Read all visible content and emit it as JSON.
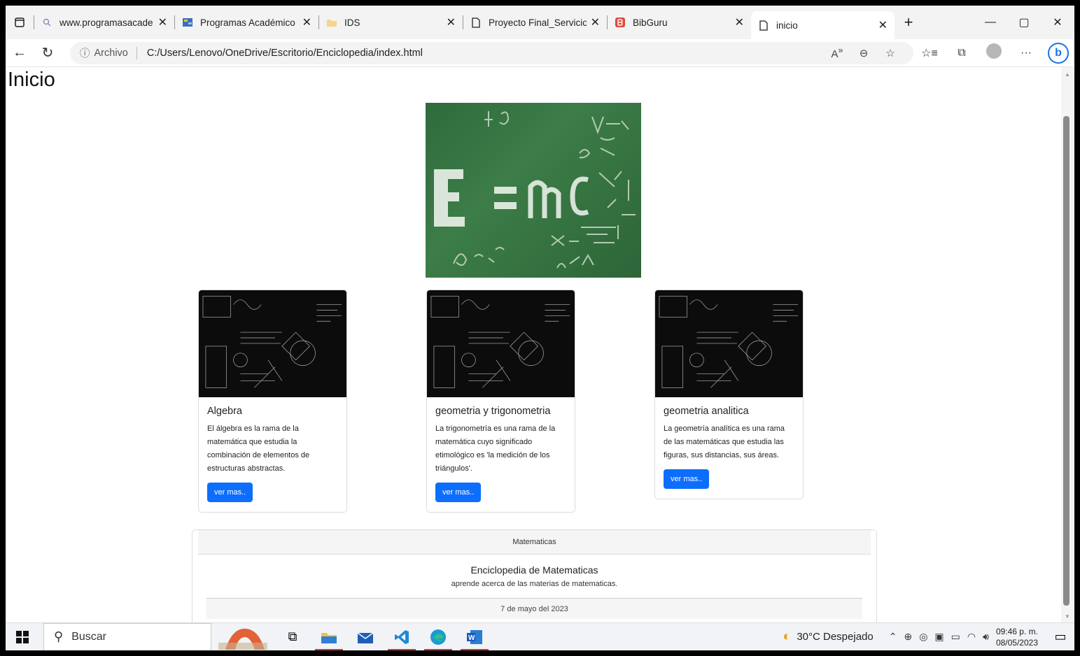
{
  "browser": {
    "tabs": [
      {
        "title": "www.programasacade",
        "icon": "search-icon"
      },
      {
        "title": "Programas Académico",
        "icon": "site-icon"
      },
      {
        "title": "IDS",
        "icon": "folder-icon"
      },
      {
        "title": "Proyecto Final_Servicio",
        "icon": "document-icon"
      },
      {
        "title": "BibGuru",
        "icon": "bibguru-icon"
      },
      {
        "title": "inicio",
        "icon": "document-icon"
      }
    ],
    "address_prefix": "Archivo",
    "url": "C:/Users/Lenovo/OneDrive/Escritorio/Enciclopedia/index.html"
  },
  "page": {
    "title": "Inicio",
    "cards": [
      {
        "title": "Algebra",
        "text": "El álgebra es la rama de la matemática que estudia la combinación de elementos de estructuras abstractas.",
        "button": "ver mas.."
      },
      {
        "title": "geometria y trigonometria",
        "text": "La trigonometría es una rama de la matemática cuyo significado etimológico es 'la medición de los triángulos'.",
        "button": "ver mas.."
      },
      {
        "title": "geometria analitica",
        "text": "La geometría analítica es una rama de las matemáticas que estudia las figuras, sus distancias, sus áreas.",
        "button": "ver mas.."
      }
    ],
    "footer": {
      "header": "Matematicas",
      "title": "Enciclopedia de Matematicas",
      "subtitle": "aprende acerca de las materias de matematicas.",
      "date": "7 de mayo del 2023"
    }
  },
  "taskbar": {
    "search": "Buscar",
    "weather": "30°C Despejado",
    "time": "09:46 p. m.",
    "date": "08/05/2023"
  },
  "colors": {
    "primary_button": "#0d6efd",
    "chalkboard": "#2f6b3d"
  }
}
